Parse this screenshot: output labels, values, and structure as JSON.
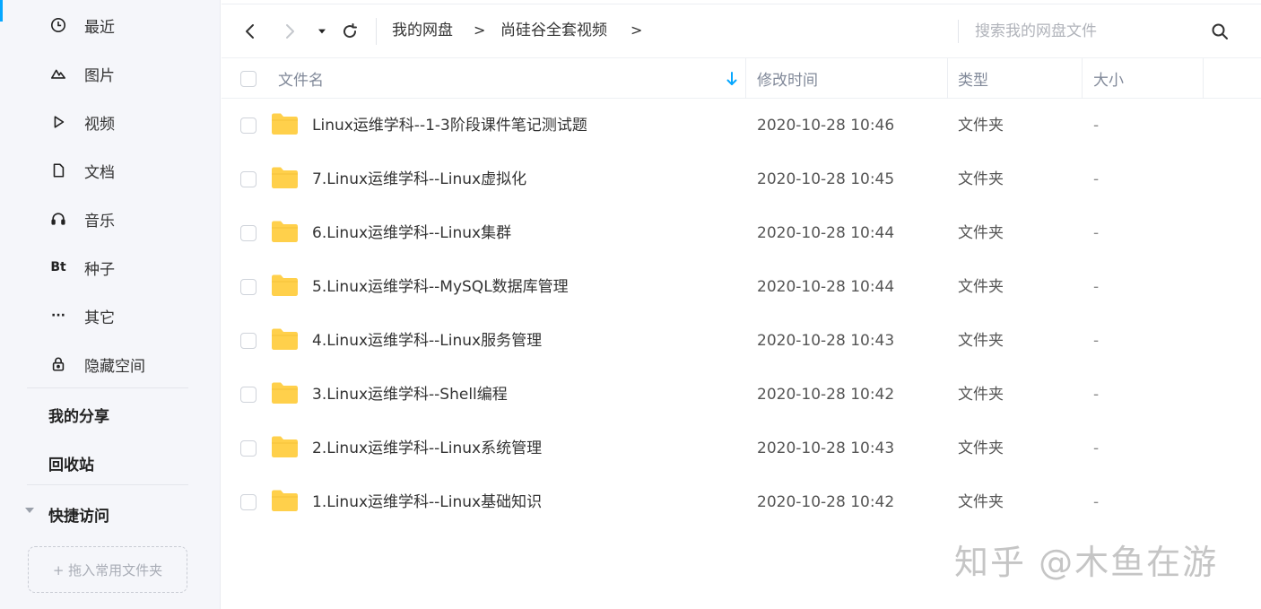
{
  "sidebar": {
    "categories": [
      {
        "label": "最近",
        "icon": "clock-icon"
      },
      {
        "label": "图片",
        "icon": "image-icon"
      },
      {
        "label": "视频",
        "icon": "play-icon"
      },
      {
        "label": "文档",
        "icon": "document-icon"
      },
      {
        "label": "音乐",
        "icon": "headphones-icon"
      },
      {
        "label": "种子",
        "icon": "bt-icon",
        "glyph": "Bt"
      },
      {
        "label": "其它",
        "icon": "more-icon",
        "glyph": "···"
      },
      {
        "label": "隐藏空间",
        "icon": "lock-icon"
      }
    ],
    "my_share": "我的分享",
    "recycle_bin": "回收站",
    "quick_access": "快捷访问",
    "drop_zone": "+ 拖入常用文件夹"
  },
  "toolbar": {
    "breadcrumb": [
      "我的网盘",
      "尚硅谷全套视频"
    ],
    "breadcrumb_separator": ">",
    "search_placeholder": "搜索我的网盘文件"
  },
  "table": {
    "columns": {
      "name": "文件名",
      "modified": "修改时间",
      "type": "类型",
      "size": "大小"
    },
    "sort": {
      "column": "name",
      "direction": "down"
    },
    "rows": [
      {
        "name": "Linux运维学科--1-3阶段课件笔记测试题",
        "modified": "2020-10-28 10:46",
        "type": "文件夹",
        "size": "-"
      },
      {
        "name": "7.Linux运维学科--Linux虚拟化",
        "modified": "2020-10-28 10:45",
        "type": "文件夹",
        "size": "-"
      },
      {
        "name": "6.Linux运维学科--Linux集群",
        "modified": "2020-10-28 10:44",
        "type": "文件夹",
        "size": "-"
      },
      {
        "name": "5.Linux运维学科--MySQL数据库管理",
        "modified": "2020-10-28 10:44",
        "type": "文件夹",
        "size": "-"
      },
      {
        "name": "4.Linux运维学科--Linux服务管理",
        "modified": "2020-10-28 10:43",
        "type": "文件夹",
        "size": "-"
      },
      {
        "name": "3.Linux运维学科--Shell编程",
        "modified": "2020-10-28 10:42",
        "type": "文件夹",
        "size": "-"
      },
      {
        "name": "2.Linux运维学科--Linux系统管理",
        "modified": "2020-10-28 10:43",
        "type": "文件夹",
        "size": "-"
      },
      {
        "name": "1.Linux运维学科--Linux基础知识",
        "modified": "2020-10-28 10:42",
        "type": "文件夹",
        "size": "-"
      }
    ]
  },
  "watermark": "知乎 @木鱼在游",
  "colors": {
    "folder": "#ffd04b",
    "accent": "#06a7ff",
    "sidebar_bg": "#f5f6fa"
  }
}
